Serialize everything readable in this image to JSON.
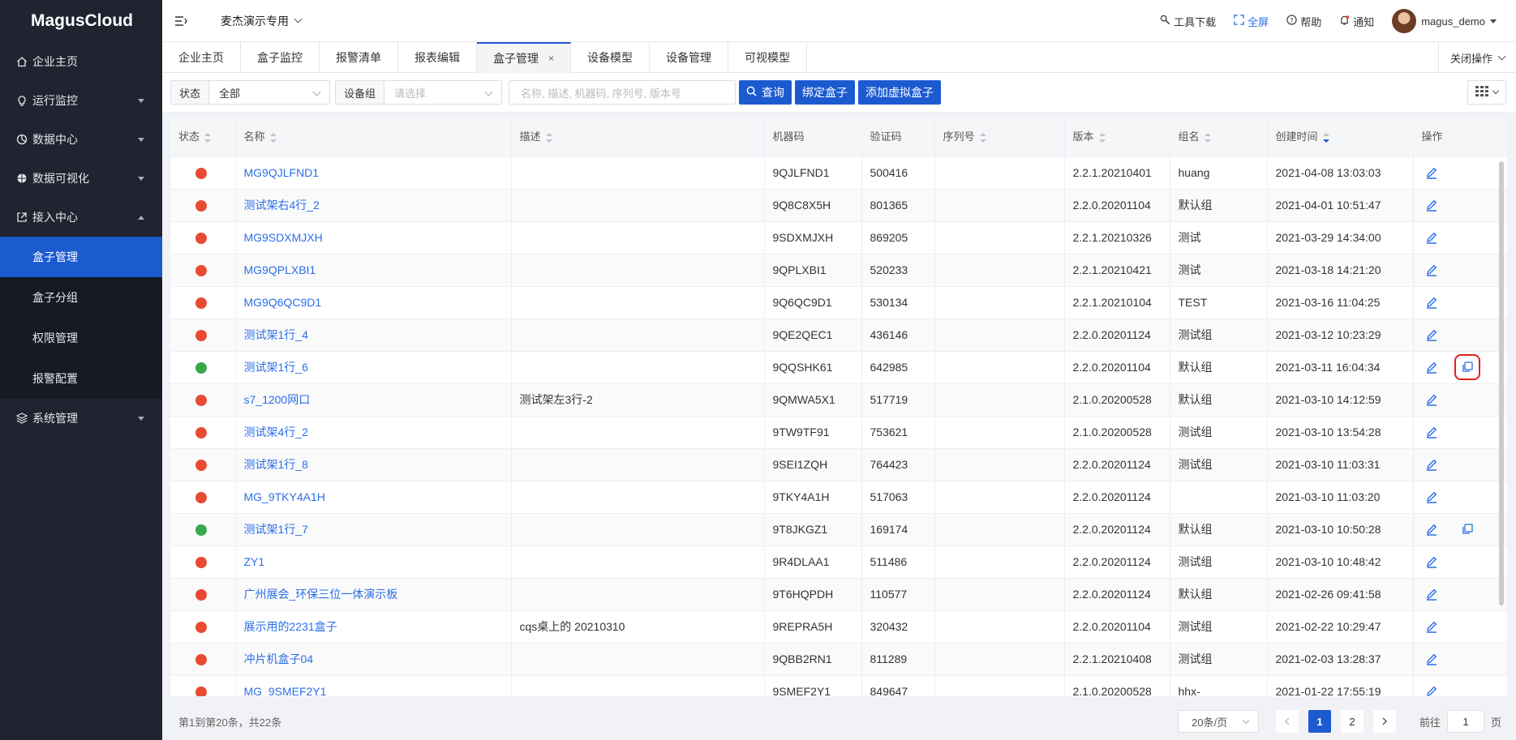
{
  "app": {
    "logo": "MagusCloud"
  },
  "sidebar": {
    "items": [
      {
        "label": "企业主页",
        "icon": "home-icon",
        "caret": ""
      },
      {
        "label": "运行监控",
        "icon": "bulb-icon",
        "caret": "down"
      },
      {
        "label": "数据中心",
        "icon": "pie-icon",
        "caret": "down"
      },
      {
        "label": "数据可视化",
        "icon": "globe-icon",
        "caret": "down"
      },
      {
        "label": "接入中心",
        "icon": "import-icon",
        "caret": "up"
      }
    ],
    "submenu": [
      {
        "label": "盒子管理",
        "active": true
      },
      {
        "label": "盒子分组",
        "active": false
      },
      {
        "label": "权限管理",
        "active": false
      },
      {
        "label": "报警配置",
        "active": false
      }
    ],
    "system": {
      "label": "系统管理",
      "icon": "layers-icon"
    }
  },
  "topbar": {
    "org": "麦杰演示专用",
    "tools": "工具下载",
    "fullscreen": "全屏",
    "help": "帮助",
    "notify": "通知",
    "user": "magus_demo"
  },
  "tabs": [
    {
      "label": "企业主页",
      "active": false
    },
    {
      "label": "盒子监控",
      "active": false
    },
    {
      "label": "报警清单",
      "active": false
    },
    {
      "label": "报表编辑",
      "active": false
    },
    {
      "label": "盒子管理",
      "active": true,
      "close": "×"
    },
    {
      "label": "设备模型",
      "active": false
    },
    {
      "label": "设备管理",
      "active": false
    },
    {
      "label": "可视模型",
      "active": false
    }
  ],
  "close_ops": "关闭操作",
  "filters": {
    "status_label": "状态",
    "status_value": "全部",
    "group_label": "设备组",
    "group_placeholder": "请选择",
    "search_placeholder": "名称, 描述, 机器码, 序列号, 版本号",
    "query": "查询",
    "bind": "绑定盒子",
    "add_virtual": "添加虚拟盒子"
  },
  "table": {
    "headers": [
      "状态",
      "名称",
      "描述",
      "机器码",
      "验证码",
      "序列号",
      "版本",
      "组名",
      "创建时间",
      "操作"
    ],
    "status_colors": {
      "offline": "#e84b32",
      "online": "#3aa84a"
    },
    "rows": [
      {
        "status": "offline",
        "name": "MG9QJLFND1",
        "desc": "",
        "code": "9QJLFND1",
        "verify": "500416",
        "serial": "",
        "version": "2.2.1.20210401",
        "group": "huang",
        "created": "2021-04-08 13:03:03",
        "copy": false
      },
      {
        "status": "offline",
        "name": "测试架右4行_2",
        "desc": "",
        "code": "9Q8C8X5H",
        "verify": "801365",
        "serial": "",
        "version": "2.2.0.20201104",
        "group": "默认组",
        "created": "2021-04-01 10:51:47",
        "copy": false
      },
      {
        "status": "offline",
        "name": "MG9SDXMJXH",
        "desc": "",
        "code": "9SDXMJXH",
        "verify": "869205",
        "serial": "",
        "version": "2.2.1.20210326",
        "group": "测试",
        "created": "2021-03-29 14:34:00",
        "copy": false
      },
      {
        "status": "offline",
        "name": "MG9QPLXBI1",
        "desc": "",
        "code": "9QPLXBI1",
        "verify": "520233",
        "serial": "",
        "version": "2.2.1.20210421",
        "group": "测试",
        "created": "2021-03-18 14:21:20",
        "copy": false
      },
      {
        "status": "offline",
        "name": "MG9Q6QC9D1",
        "desc": "",
        "code": "9Q6QC9D1",
        "verify": "530134",
        "serial": "",
        "version": "2.2.1.20210104",
        "group": "TEST",
        "created": "2021-03-16 11:04:25",
        "copy": false
      },
      {
        "status": "offline",
        "name": "测试架1行_4",
        "desc": "",
        "code": "9QE2QEC1",
        "verify": "436146",
        "serial": "",
        "version": "2.2.0.20201124",
        "group": "测试组",
        "created": "2021-03-12 10:23:29",
        "copy": false
      },
      {
        "status": "online",
        "name": "测试架1行_6",
        "desc": "",
        "code": "9QQSHK61",
        "verify": "642985",
        "serial": "",
        "version": "2.2.0.20201104",
        "group": "默认组",
        "created": "2021-03-11 16:04:34",
        "copy": true,
        "highlight": true
      },
      {
        "status": "offline",
        "name": "s7_1200网口",
        "desc": "测试架左3行-2",
        "code": "9QMWA5X1",
        "verify": "517719",
        "serial": "",
        "version": "2.1.0.20200528",
        "group": "默认组",
        "created": "2021-03-10 14:12:59",
        "copy": false
      },
      {
        "status": "offline",
        "name": "测试架4行_2",
        "desc": "",
        "code": "9TW9TF91",
        "verify": "753621",
        "serial": "",
        "version": "2.1.0.20200528",
        "group": "测试组",
        "created": "2021-03-10 13:54:28",
        "copy": false
      },
      {
        "status": "offline",
        "name": "测试架1行_8",
        "desc": "",
        "code": "9SEI1ZQH",
        "verify": "764423",
        "serial": "",
        "version": "2.2.0.20201124",
        "group": "测试组",
        "created": "2021-03-10 11:03:31",
        "copy": false
      },
      {
        "status": "offline",
        "name": "MG_9TKY4A1H",
        "desc": "",
        "code": "9TKY4A1H",
        "verify": "517063",
        "serial": "",
        "version": "2.2.0.20201124",
        "group": "",
        "created": "2021-03-10 11:03:20",
        "copy": false
      },
      {
        "status": "online",
        "name": "测试架1行_7",
        "desc": "",
        "code": "9T8JKGZ1",
        "verify": "169174",
        "serial": "",
        "version": "2.2.0.20201124",
        "group": "默认组",
        "created": "2021-03-10 10:50:28",
        "copy": true
      },
      {
        "status": "offline",
        "name": "ZY1",
        "desc": "",
        "code": "9R4DLAA1",
        "verify": "511486",
        "serial": "",
        "version": "2.2.0.20201124",
        "group": "测试组",
        "created": "2021-03-10 10:48:42",
        "copy": false
      },
      {
        "status": "offline",
        "name": "广州展会_环保三位一体演示板",
        "desc": "",
        "code": "9T6HQPDH",
        "verify": "110577",
        "serial": "",
        "version": "2.2.0.20201124",
        "group": "默认组",
        "created": "2021-02-26 09:41:58",
        "copy": false
      },
      {
        "status": "offline",
        "name": "展示用的2231盒子",
        "desc": "cqs桌上的 20210310",
        "code": "9REPRA5H",
        "verify": "320432",
        "serial": "",
        "version": "2.2.0.20201104",
        "group": "测试组",
        "created": "2021-02-22 10:29:47",
        "copy": false
      },
      {
        "status": "offline",
        "name": "冲片机盒子04",
        "desc": "",
        "code": "9QBB2RN1",
        "verify": "811289",
        "serial": "",
        "version": "2.2.1.20210408",
        "group": "测试组",
        "created": "2021-02-03 13:28:37",
        "copy": false
      },
      {
        "status": "offline",
        "name": "MG_9SMEF2Y1",
        "desc": "",
        "code": "9SMEF2Y1",
        "verify": "849647",
        "serial": "",
        "version": "2.1.0.20200528",
        "group": "hhx-",
        "created": "2021-01-22 17:55:19",
        "copy": false
      }
    ]
  },
  "pager": {
    "info": "第1到第20条，共22条",
    "size": "20条/页",
    "page1": "1",
    "page2": "2",
    "goto_label": "前往",
    "goto_value": "1",
    "goto_suffix": "页"
  }
}
